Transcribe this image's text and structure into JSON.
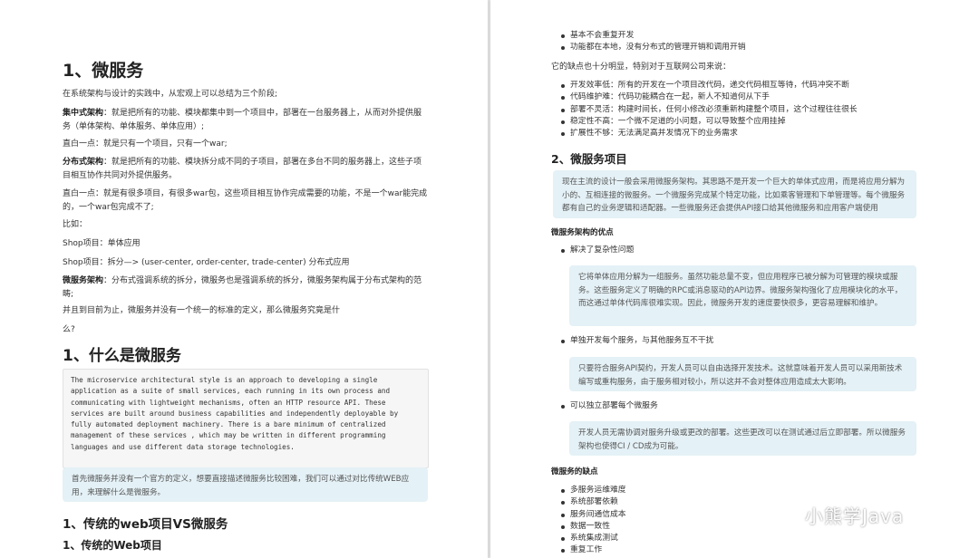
{
  "left": {
    "h1_title": "1、微服务",
    "intro": "在系统架构与设计的实践中，从宏观上可以总结为三个阶段;",
    "centralized_label": "集中式架构",
    "centralized_text": "：就是把所有的功能、模块都集中到一个项目中，部署在一台服务器上，从而对外提供服务（单体架构、单体服务、单体应用）;",
    "plain1": "直白一点：就是只有一个项目，只有一个war;",
    "distributed_label": "分布式架构",
    "distributed_text": "：就是把所有的功能、模块拆分成不同的子项目，部署在多台不同的服务器上，这些子项目相互协作共同对外提供服务。",
    "plain2": "直白一点：就是有很多项目，有很多war包，这些项目相互协作完成需要的功能，不是一个war能完成的，一个war包完成不了;",
    "example": "比如：",
    "shop1": "Shop项目：单体应用",
    "shop2": "Shop项目：拆分—> (user-center, order-center, trade-center) 分布式应用",
    "micro_label": "微服务架构",
    "micro_text": "：分布式强调系统的拆分，微服务也是强调系统的拆分，微服务架构属于分布式架构的范畴;",
    "para_last": "并且到目前为止，微服务并没有一个统一的标准的定义，那么微服务究竟是什",
    "para_last2": "么?",
    "h1_what": "1、什么是微服务",
    "code": "The microservice architectural style is an approach to developing a single\napplication as a suite of small services, each running in its own process and\ncommunicating with lightweight mechanisms, often an HTTP resource API. These\nservices are built around business capabilities and independently deployable by\nfully automated deployment machinery. There is a bare minimum of centralized\nmanagement of these services , which may be written in different programming\nlanguages and use different data storage technologies.",
    "note": "首先微服务并没有一个官方的定义，想要直接描述微服务比较困难，我们可以通过对比传统WEB应用，来理解什么是微服务。",
    "h2_compare": "1、传统的web项目VS微服务",
    "h2_traditional": "1、传统的Web项目"
  },
  "right": {
    "top_bullets": [
      "基本不会重复开发",
      "功能都在本地，没有分布式的管理开销和调用开销"
    ],
    "drawback_intro": "它的缺点也十分明显，特别对于互联网公司来说：",
    "drawbacks": [
      "开发效率低：所有的开发在一个项目改代码，递交代码相互等待，代码冲突不断",
      "代码维护难：代码功能耦合在一起，新人不知道何从下手",
      "部署不灵活：构建时间长，任何小修改必须重新构建整个项目，这个过程往往很长",
      "稳定性不高：一个微不足道的小问题，可以导致整个应用挂掉",
      "扩展性不够：无法满足高并发情况下的业务需求"
    ],
    "h2_micro": "2、微服务项目",
    "note_micro": "现在主流的设计一般会采用微服务架构。其思路不是开发一个巨大的单体式应用，而是将应用分解为小的、互相连接的微服务。一个微服务完成某个特定功能，比如乘客管理和下单管理等。每个微服务都有自己的业务逻辑和适配器。一些微服务还会提供API接口给其他微服务和应用客户端使用",
    "adv_title": "微服务架构的优点",
    "adv1": "解决了复杂性问题",
    "adv1_note": "它将单体应用分解为一组服务。虽然功能总量不变，但应用程序已被分解为可管理的模块或服务。这些服务定义了明确的RPC或消息驱动的API边界。微服务架构强化了应用模块化的水平，而这通过单体代码库很难实现。因此，微服务开发的速度要快很多，更容易理解和维护。",
    "adv2": "单独开发每个服务，与其他服务互不干扰",
    "adv2_note": "只要符合服务API契约，开发人员可以自由选择开发技术。这就意味着开发人员可以采用新技术编写或重构服务，由于服务相对较小，所以这并不会对整体应用造成太大影响。",
    "adv3": "可以独立部署每个微服务",
    "adv3_note": "开发人员无需协调对服务升级或更改的部署。这些更改可以在测试通过后立即部署。所以微服务架构也使得CI / CD成为可能。",
    "dis_title": "微服务的缺点",
    "disadvantages": [
      "多服务运维难度",
      "系统部署依赖",
      "服务间通信成本",
      "数据一致性",
      "系统集成测试",
      "重复工作"
    ],
    "watermark": "小熊学Java"
  }
}
